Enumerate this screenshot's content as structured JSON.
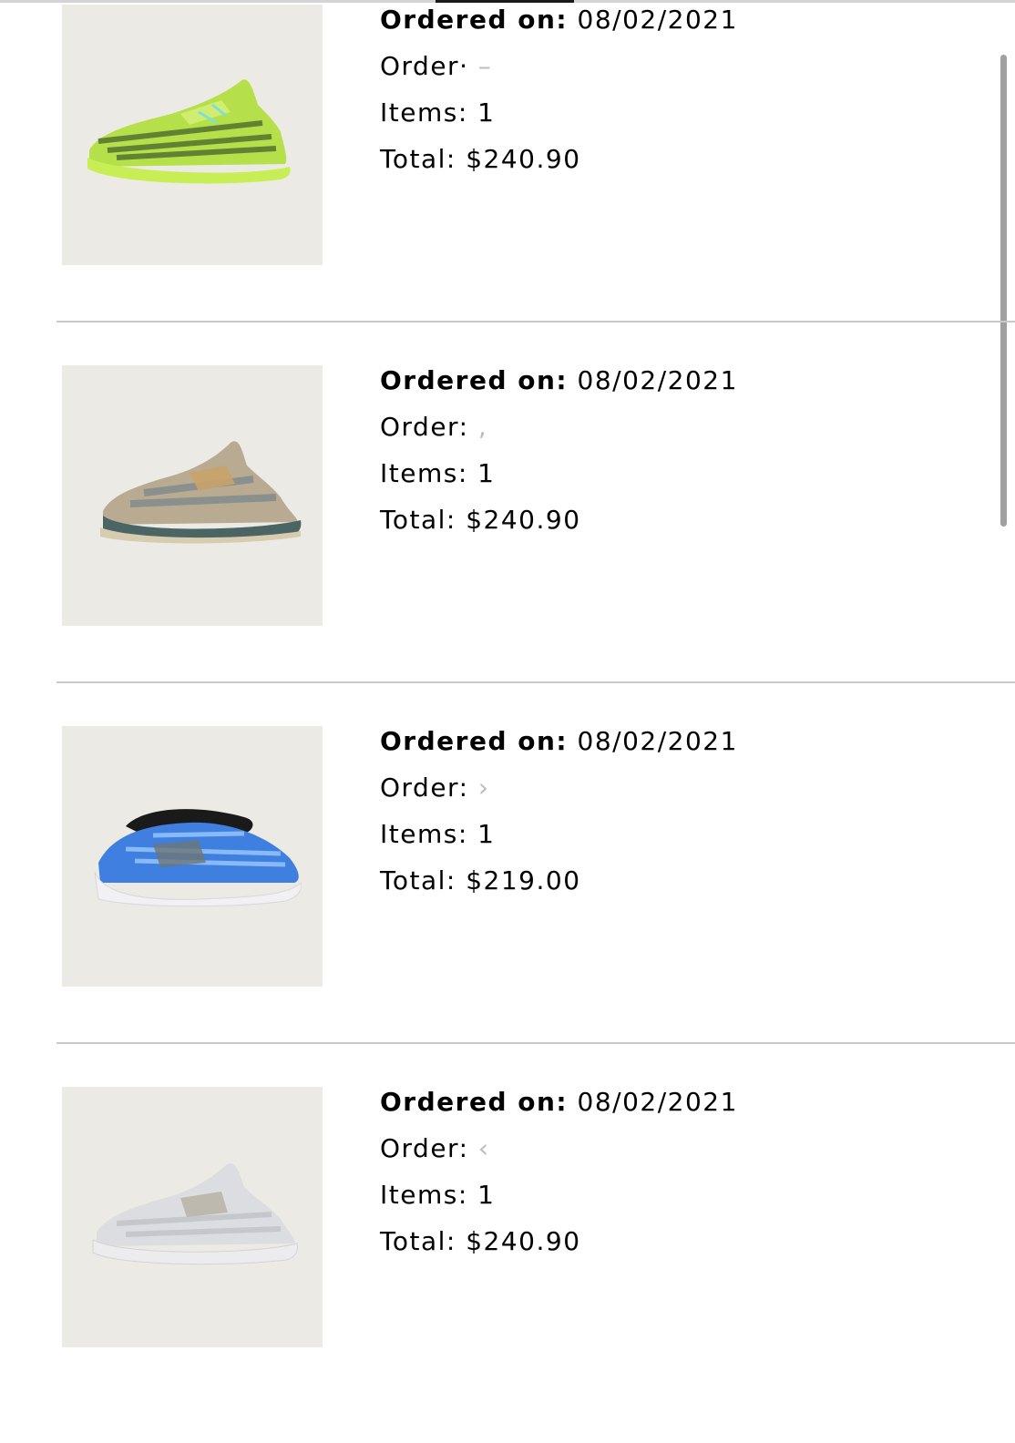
{
  "labels": {
    "ordered_on": "Ordered on:",
    "order": "Order:",
    "items": "Items:",
    "total": "Total:"
  },
  "orders": [
    {
      "date": "08/02/2021",
      "order_label": "Order·",
      "order_number": "",
      "items": "1",
      "total": "$240.90",
      "product_icon": "sneaker-yellow-icon",
      "colors": {
        "upper": "#b5e04a",
        "sole": "#c8ee55",
        "stripe": "#3e5a2a"
      }
    },
    {
      "date": "08/02/2021",
      "order_label": "Order:",
      "order_number": "",
      "items": "1",
      "total": "$240.90",
      "product_icon": "sneaker-grey-tan-icon",
      "colors": {
        "upper": "#b9ab92",
        "sole": "#4b6464",
        "stripe": "#7d8a8d"
      }
    },
    {
      "date": "08/02/2021",
      "order_label": "Order:",
      "order_number": "",
      "items": "1",
      "total": "$219.00",
      "product_icon": "sneaker-blue-icon",
      "colors": {
        "upper": "#3e7fe0",
        "sole": "#f1f1f3",
        "stripe": "#1a1a1a"
      }
    },
    {
      "date": "08/02/2021",
      "order_label": "Order:",
      "order_number": "",
      "items": "1",
      "total": "$240.90",
      "product_icon": "sneaker-white-icon",
      "colors": {
        "upper": "#dcdde0",
        "sole": "#ececee",
        "stripe": "#b9b5a8"
      }
    }
  ]
}
